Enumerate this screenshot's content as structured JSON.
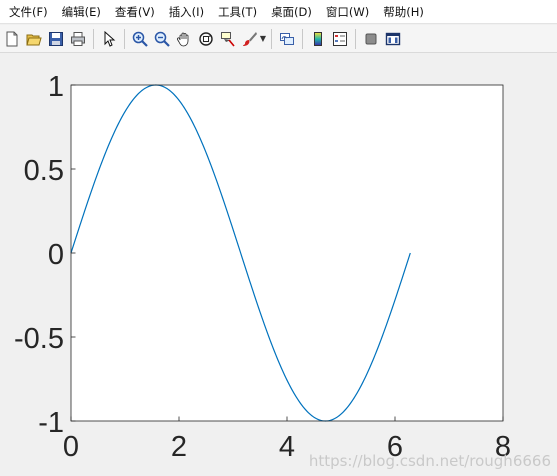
{
  "menubar": {
    "items": [
      {
        "label": "文件(F)"
      },
      {
        "label": "编辑(E)"
      },
      {
        "label": "查看(V)"
      },
      {
        "label": "插入(I)"
      },
      {
        "label": "工具(T)"
      },
      {
        "label": "桌面(D)"
      },
      {
        "label": "窗口(W)"
      },
      {
        "label": "帮助(H)"
      }
    ]
  },
  "toolbar": {
    "buttons": [
      {
        "icon": "new-figure-icon"
      },
      {
        "icon": "open-file-icon"
      },
      {
        "icon": "save-icon"
      },
      {
        "icon": "print-icon"
      },
      {
        "icon": "edit-plot-arrow-icon"
      },
      {
        "icon": "zoom-in-icon"
      },
      {
        "icon": "zoom-out-icon"
      },
      {
        "icon": "pan-hand-icon"
      },
      {
        "icon": "rotate-3d-icon"
      },
      {
        "icon": "data-cursor-icon"
      },
      {
        "icon": "brush-icon"
      },
      {
        "icon": "link-plot-icon"
      },
      {
        "icon": "insert-colorbar-icon"
      },
      {
        "icon": "insert-legend-icon"
      },
      {
        "icon": "hide-plot-tools-icon"
      },
      {
        "icon": "show-plot-tools-icon"
      }
    ]
  },
  "chart_data": {
    "type": "line",
    "function": "sin(x)",
    "x_range": [
      0,
      6.2832
    ],
    "xlim": [
      0,
      8
    ],
    "ylim": [
      -1,
      1
    ],
    "xticks": [
      "0",
      "2",
      "4",
      "6",
      "8"
    ],
    "yticks": [
      "1",
      "0.5",
      "0",
      "-0.5",
      "-1"
    ],
    "xtick_values": [
      0,
      2,
      4,
      6,
      8
    ],
    "ytick_values": [
      1,
      0.5,
      0,
      -0.5,
      -1
    ],
    "series_color": "#0072BD",
    "grid": false,
    "title": "",
    "xlabel": "",
    "ylabel": ""
  },
  "watermark": "https://blog.csdn.net/rough6666"
}
